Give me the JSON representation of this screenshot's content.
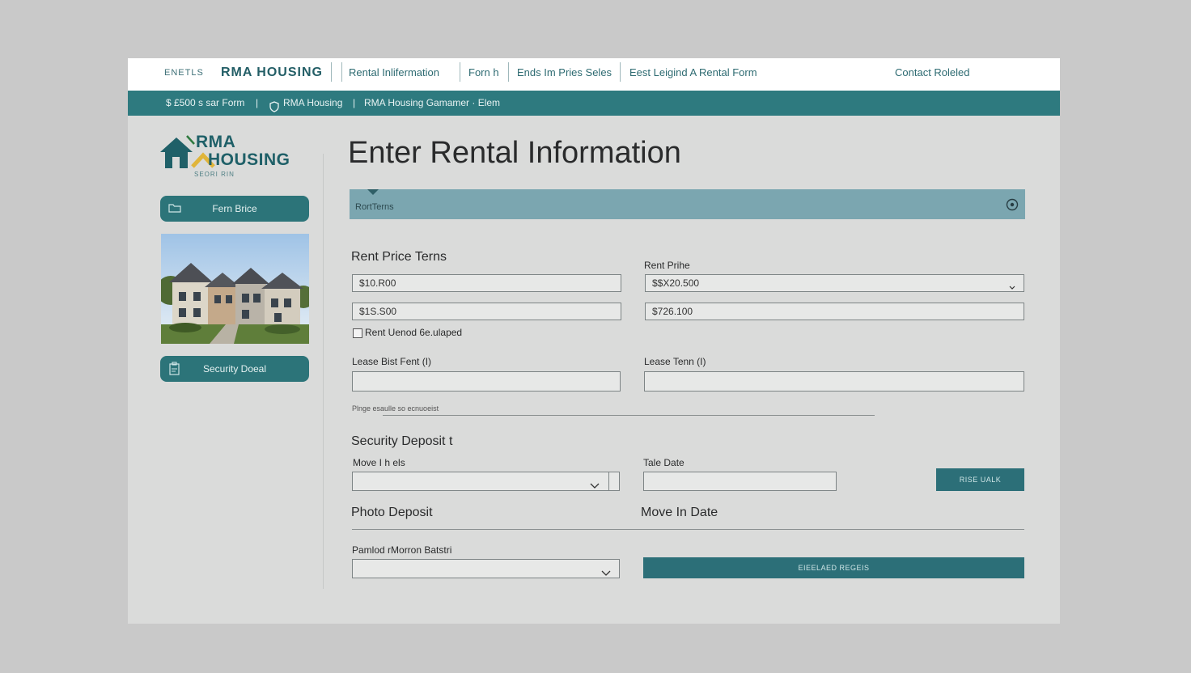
{
  "topnav": {
    "items": [
      "ENETLS",
      "RMA HOUSING",
      "Rental Inlifermation",
      "Forn h",
      "Ends Im Pries Seles",
      "Eest Leigind A Rental Form",
      "Contact Roleled"
    ]
  },
  "subbar": {
    "items": [
      "$ £500 s sar Form",
      "|",
      "RMA Housing",
      "|",
      "RMA Housing Gamamer · Elem"
    ]
  },
  "logo": {
    "line1": "RMA",
    "line2": "HOUSING",
    "tagline": "SEORI RIN"
  },
  "sidebar": {
    "buttons": [
      "Fern Brice",
      "Security Doeal"
    ]
  },
  "main": {
    "title": "Enter Rental Information",
    "accordion_label": "RortTerns",
    "section1_title": "Rent Price Terns",
    "rent_price_label": "Rent Prihe",
    "field_left_1": "$10.R00",
    "field_right_1": "$$X20.500",
    "field_left_2": "$1S.S00",
    "field_right_2": "$726.100",
    "checkbox_label": "Rent Uenod 6e.ulaped",
    "lease_start_label": "Lease Bist Fent (I)",
    "lease_term_label": "Lease Tenn (I)",
    "hint_text": "Plnge esaulle so ecnuoeist",
    "security_title": "Security Deposit t",
    "move_label": "Move I h els",
    "tale_date_label": "Tale Date",
    "small_button": "RISE UALK",
    "photo_deposit": "Photo Deposit",
    "move_in_date": "Move In Date",
    "pamlod_label": "Pamlod rMorron Batstri",
    "submit_button": "EIEELAED REGEIS"
  },
  "colors": {
    "teal": "#2c7479",
    "teal_dark": "#1f6068",
    "accordion": "#7ba6b0",
    "window_bg": "#dadbda"
  },
  "icons": {
    "folder": "folder-icon",
    "deposit": "clipboard-icon",
    "gear": "gear-icon",
    "chevron": "chevron-down-icon",
    "shield": "shield-icon"
  }
}
